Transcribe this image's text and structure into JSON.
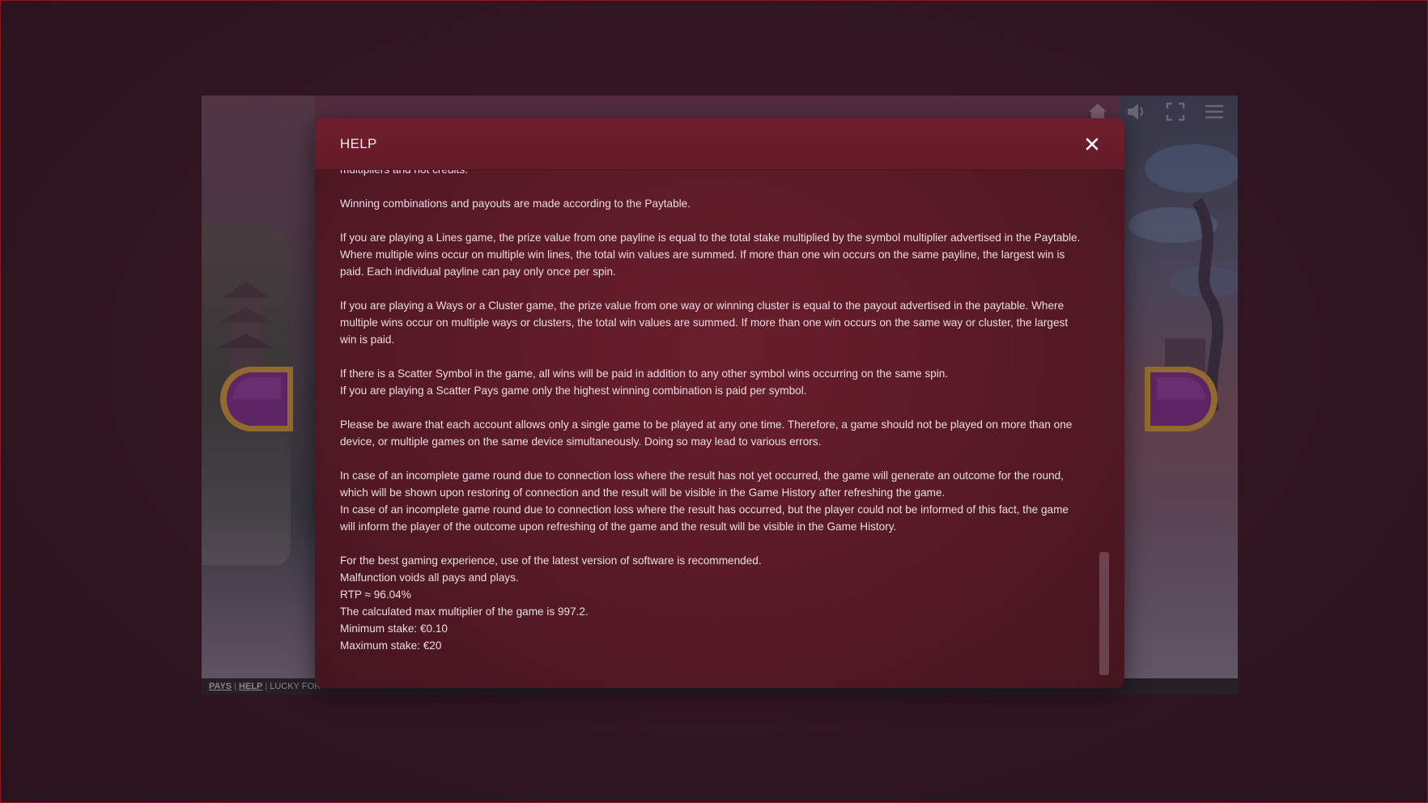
{
  "modal": {
    "title": "HELP",
    "paragraphs": [
      [
        "multipliers and not credits."
      ],
      [
        "Winning combinations and payouts are made according to the Paytable."
      ],
      [
        "If you are playing a Lines game, the prize value from one payline is equal to the total stake multiplied by the symbol multiplier advertised in the Paytable. Where multiple wins occur on multiple win lines, the total win values are summed. If more than one win occurs on the same payline, the largest win is paid. Each individual payline can pay only once per spin."
      ],
      [
        "If you are playing a Ways or a Cluster game, the prize value from one way or winning cluster is equal to the payout advertised in the paytable. Where multiple wins occur on multiple ways or clusters, the total win values are summed. If more than one win occurs on the same way or cluster, the largest win is paid."
      ],
      [
        "If there is a Scatter Symbol in the game, all wins will be paid in addition to any other symbol wins occurring on the same spin.",
        "If you are playing a Scatter Pays game only the highest winning combination is paid per symbol."
      ],
      [
        "Please be aware that each account allows only a single game to be played at any one time. Therefore, a game should not be played on more than one device, or multiple games on the same device simultaneously. Doing so may lead to various errors."
      ],
      [
        "In case of an incomplete game round due to connection loss where the result has not yet occurred, the game will generate an outcome for the round, which will be shown upon restoring of connection and the result will be visible in the Game History after refreshing the game.",
        "In case of an incomplete game round due to connection loss where the result has occurred, but the player could not be informed of this fact, the game will inform the player of the outcome upon refreshing of the game and the result will be visible in the Game History."
      ],
      [
        "For the best gaming experience, use of the latest version of software is recommended.",
        "Malfunction voids all pays and plays.",
        "RTP ≈ 96.04%",
        "The calculated max multiplier of the game is 997.2.",
        "Minimum stake: €0.10",
        "Maximum stake: €20"
      ]
    ]
  },
  "footer": {
    "pays": "PAYS",
    "help": "HELP",
    "game_name": "LUCKY FOR"
  },
  "icons": {
    "home": "home-icon",
    "sound": "speaker-icon",
    "fullscreen": "fullscreen-icon",
    "menu": "menu-icon",
    "close": "close-icon",
    "prev": "arrow-left-icon",
    "next": "arrow-right-icon"
  },
  "colors": {
    "modal_bg": "#5a1a26",
    "header_bg": "#6e1e2c",
    "text": "#e8dde2",
    "arrow_purple": "#7a2f8a",
    "arrow_gold": "#c89a3a"
  }
}
